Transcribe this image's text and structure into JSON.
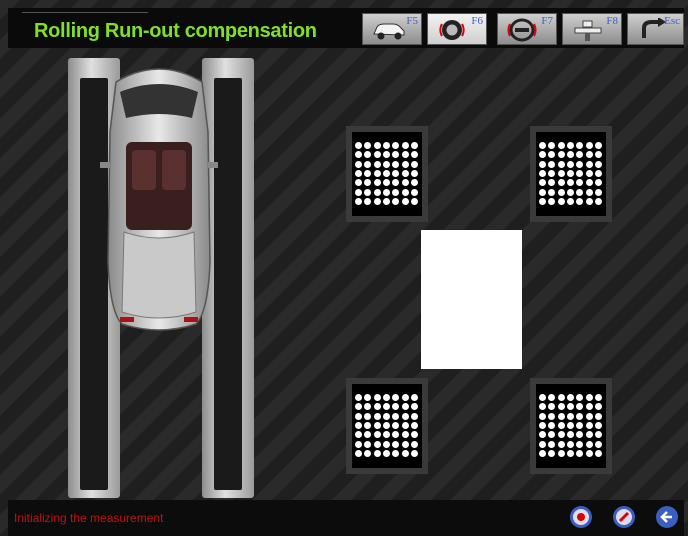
{
  "header": {
    "title": "Rolling Run-out compensation",
    "tools": [
      {
        "key": "F5",
        "icon": "car-icon"
      },
      {
        "key": "F6",
        "icon": "wheel-icon",
        "active": true
      },
      {
        "key": "F7",
        "icon": "steering-wheel-icon"
      },
      {
        "key": "F8",
        "icon": "lift-icon"
      },
      {
        "key": "Esc",
        "icon": "back-arrow-icon"
      }
    ]
  },
  "status": {
    "text": "Initializing the measurement",
    "color": "#c01212"
  },
  "footer_buttons": [
    {
      "icon": "wheel-measure-icon"
    },
    {
      "icon": "wheel-settings-icon"
    },
    {
      "icon": "back-icon"
    }
  ],
  "colors": {
    "title": "#7fe02a",
    "key_label": "#3a5fcf",
    "target_dot": "#ffffff"
  }
}
